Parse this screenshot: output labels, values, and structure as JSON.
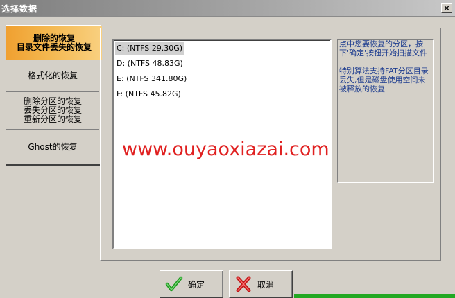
{
  "window": {
    "title": "选择数据",
    "close_glyph": "×"
  },
  "tabs": [
    {
      "label_lines": [
        "删除的恢复",
        "目录文件丢失的恢复"
      ],
      "active": true
    },
    {
      "label_lines": [
        "格式化的恢复"
      ],
      "active": false
    },
    {
      "label_lines": [
        "删除分区的恢复",
        "丢失分区的恢复",
        "重新分区的恢复"
      ],
      "active": false
    },
    {
      "label_lines": [
        "Ghost的恢复"
      ],
      "active": false
    }
  ],
  "drives": [
    {
      "text": "C:  (NTFS 29.30G)",
      "selected": true
    },
    {
      "text": "D:  (NTFS 48.83G)",
      "selected": false
    },
    {
      "text": "E:  (NTFS 341.80G)",
      "selected": false
    },
    {
      "text": "F:  (NTFS 45.82G)",
      "selected": false
    }
  ],
  "info": {
    "paragraph1": "点中您要恢复的分区，按下'确定'按钮开始扫描文件",
    "paragraph2": "特别算法支持FAT分区目录丢失,但是磁盘使用空间未被释放的恢复"
  },
  "watermark": "www.ouyaoxiazai.com",
  "buttons": {
    "ok_label": "确定",
    "cancel_label": "取消"
  },
  "colors": {
    "active_tab": "#f4b850",
    "info_text": "#1d3c8f",
    "watermark": "#e02020",
    "ok_icon": "#1e9a1e",
    "cancel_icon": "#c01818"
  }
}
